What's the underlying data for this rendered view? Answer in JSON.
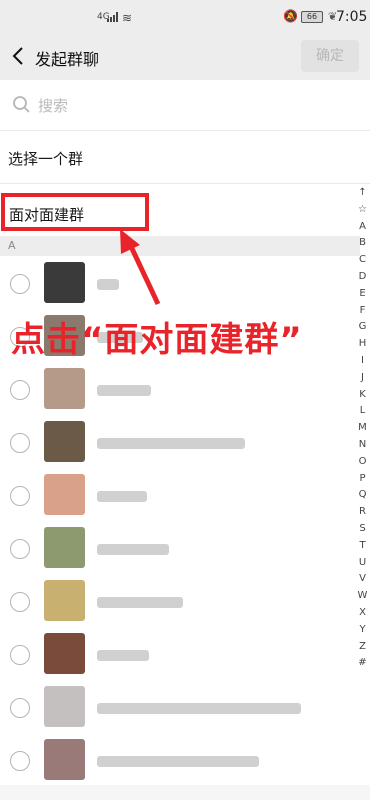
{
  "status_bar": {
    "network": "4G",
    "battery": "66",
    "time": "7:05"
  },
  "header": {
    "title": "发起群聊",
    "confirm_label": "确定"
  },
  "search": {
    "placeholder": "搜索"
  },
  "menu": {
    "select_group": "选择一个群",
    "face_to_face": "面对面建群"
  },
  "section": "A",
  "contacts": [
    {
      "name": "",
      "avatar_color": "#3a3a3a"
    },
    {
      "name": "",
      "avatar_color": "#8a7a6e"
    },
    {
      "name": "",
      "avatar_color": "#b59a8a"
    },
    {
      "name": "",
      "avatar_color": "#6b5a48"
    },
    {
      "name": "",
      "avatar_color": "#d9a08a"
    },
    {
      "name": "",
      "avatar_color": "#8d9a70"
    },
    {
      "name": "",
      "avatar_color": "#c8b070"
    },
    {
      "name": "",
      "avatar_color": "#7a4a3a"
    },
    {
      "name": "",
      "avatar_color": "#c5c0c0"
    },
    {
      "name": "",
      "avatar_color": "#9a7a78"
    }
  ],
  "index_letters": [
    "↑",
    "☆",
    "A",
    "B",
    "C",
    "D",
    "E",
    "F",
    "G",
    "H",
    "I",
    "J",
    "K",
    "L",
    "M",
    "N",
    "O",
    "P",
    "Q",
    "R",
    "S",
    "T",
    "U",
    "V",
    "W",
    "X",
    "Y",
    "Z",
    "#"
  ],
  "annotation": {
    "text": "点击“面对面建群”",
    "color": "#e8242a"
  }
}
